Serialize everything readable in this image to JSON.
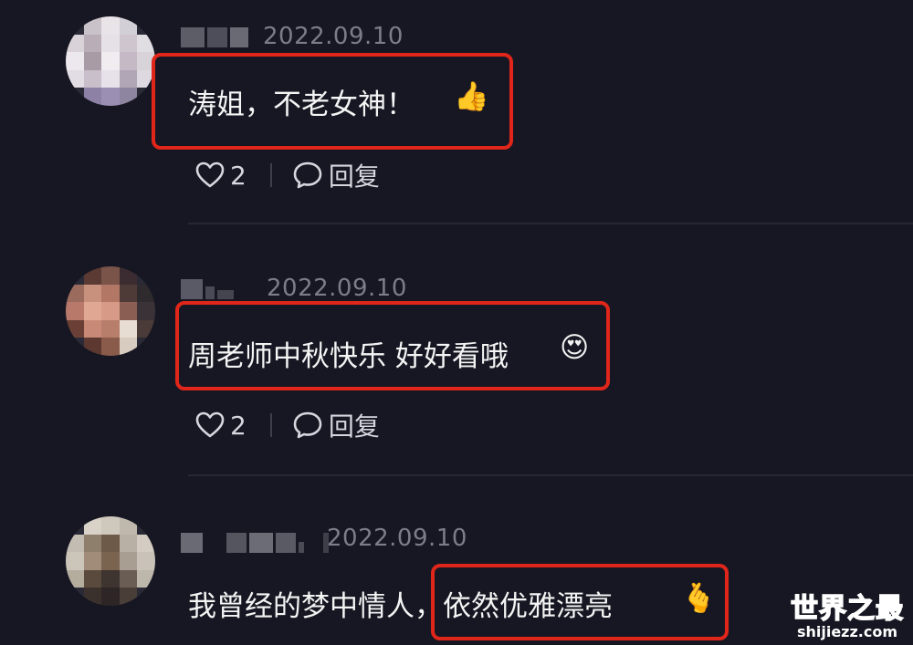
{
  "comments": [
    {
      "date": "2022.09.10",
      "text": "涛姐，不老女神！",
      "emoji": "👍",
      "likes": "2",
      "reply_label": "回复"
    },
    {
      "date": "2022.09.10",
      "text": "周老师中秋快乐 好好看哦",
      "emoji": "😍",
      "likes": "2",
      "reply_label": "回复"
    },
    {
      "date": "2022.09.10",
      "text_prefix": "我曾经的梦中情人，",
      "text_highlight": "依然优雅漂亮",
      "emoji": "🫰"
    }
  ],
  "watermark": {
    "title": "世界之最",
    "site": "shijiezz.com"
  },
  "colors": {
    "background": "#171723",
    "highlight_border": "#e0261a",
    "date_text": "#7d7d89",
    "watermark_blue": "#1f8ef5"
  }
}
